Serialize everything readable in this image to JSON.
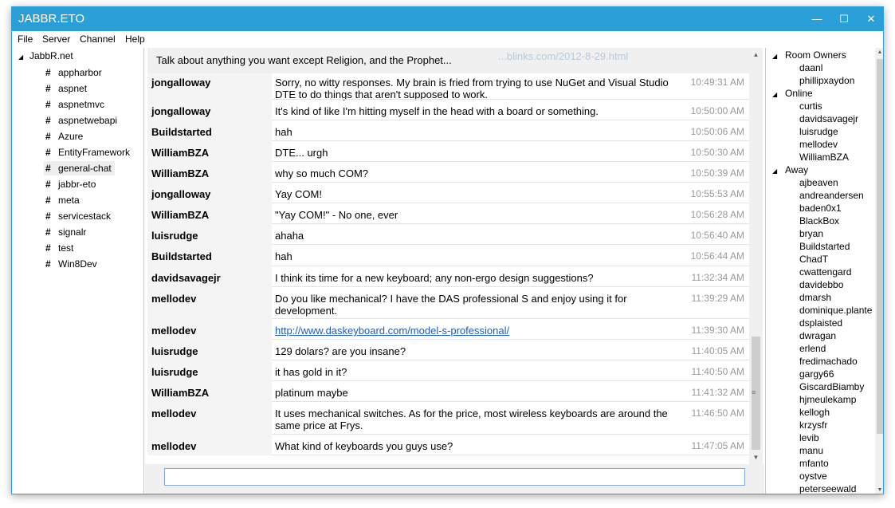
{
  "window": {
    "title": "JABBR.ETO"
  },
  "menu": [
    "File",
    "Server",
    "Channel",
    "Help"
  ],
  "tree": {
    "root": "JabbR.net",
    "rooms": [
      "appharbor",
      "aspnet",
      "aspnetmvc",
      "aspnetwebapi",
      "Azure",
      "EntityFramework",
      "general-chat",
      "jabbr-eto",
      "meta",
      "servicestack",
      "signalr",
      "test",
      "Win8Dev"
    ],
    "selected_room": "general-chat"
  },
  "chat": {
    "topic": "Talk about anything you want except Religion, and the Prophet...",
    "topic_background_link": "...blinks.com/2012-8-29.html",
    "messages": [
      {
        "user": "jongalloway",
        "text": "Sorry, no witty responses. My brain is fried from trying to use NuGet and Visual Studio DTE to do things that aren't supposed to work.",
        "time": "10:49:31 AM"
      },
      {
        "user": "jongalloway",
        "text": "It's kind of like I'm hitting myself in the head with a board or something.",
        "time": "10:50:00 AM"
      },
      {
        "user": "Buildstarted",
        "text": "hah",
        "time": "10:50:06 AM"
      },
      {
        "user": "WilliamBZA",
        "text": "DTE... urgh",
        "time": "10:50:30 AM"
      },
      {
        "user": "WilliamBZA",
        "text": "why so much COM?",
        "time": "10:50:39 AM"
      },
      {
        "user": "jongalloway",
        "text": "Yay COM!",
        "time": "10:55:53 AM"
      },
      {
        "user": "WilliamBZA",
        "text": "\"Yay COM!\" - No one, ever",
        "time": "10:56:28 AM"
      },
      {
        "user": "luisrudge",
        "text": "ahaha",
        "time": "10:56:40 AM"
      },
      {
        "user": "Buildstarted",
        "text": "hah",
        "time": "10:56:44 AM"
      },
      {
        "user": "davidsavagejr",
        "text": "I think its time for a new keyboard; any non-ergo design suggestions?",
        "time": "11:32:34 AM"
      },
      {
        "user": "mellodev",
        "text": "Do you like mechanical? I have the DAS professional S and enjoy using it for development.",
        "time": "11:39:29 AM"
      },
      {
        "user": "mellodev",
        "text": "http://www.daskeyboard.com/model-s-professional/",
        "time": "11:39:30 AM",
        "is_link": true
      },
      {
        "user": "luisrudge",
        "text": "129 dolars? are you insane?",
        "time": "11:40:05 AM"
      },
      {
        "user": "luisrudge",
        "text": "it has gold in it?",
        "time": "11:40:50 AM"
      },
      {
        "user": "WilliamBZA",
        "text": "platinum maybe",
        "time": "11:41:32 AM"
      },
      {
        "user": "mellodev",
        "text": "It uses mechanical switches. As for the price, most wireless keyboards are around the same price at Frys.",
        "time": "11:46:50 AM"
      },
      {
        "user": "mellodev",
        "text": "What kind of keyboards you guys use?",
        "time": "11:47:05 AM"
      }
    ],
    "input": {
      "value": "",
      "placeholder": ""
    }
  },
  "users": {
    "groups": [
      {
        "name": "Room Owners",
        "members": [
          "daanl",
          "phillipхaydon"
        ]
      },
      {
        "name": "Online",
        "members": [
          "curtis",
          "davidsavagejr",
          "luisrudge",
          "mellodev",
          "WilliamBZA"
        ]
      },
      {
        "name": "Away",
        "members": [
          "ajbeaven",
          "andreandersen",
          "baden0x1",
          "BlackBox",
          "bryan",
          "Buildstarted",
          "ChadT",
          "cwattengard",
          "davidebbo",
          "dmarsh",
          "dominique.plante",
          "dsplaisted",
          "dwragan",
          "erlend",
          "fredimachado",
          "gargy66",
          "GiscardBiamby",
          "hjmeulekamp",
          "kellogh",
          "krzysfr",
          "levib",
          "manu",
          "mfanto",
          "oystve",
          "peterseewald"
        ]
      }
    ]
  },
  "colors": {
    "accent": "#2a9fd8",
    "link": "#1d5bc6",
    "timestamp": "#9a9a9a"
  },
  "icons": {
    "minimize": "minimize-icon",
    "maximize": "maximize-icon",
    "close": "close-icon",
    "room": "hash-icon",
    "expand": "triangle-expanded-icon"
  }
}
